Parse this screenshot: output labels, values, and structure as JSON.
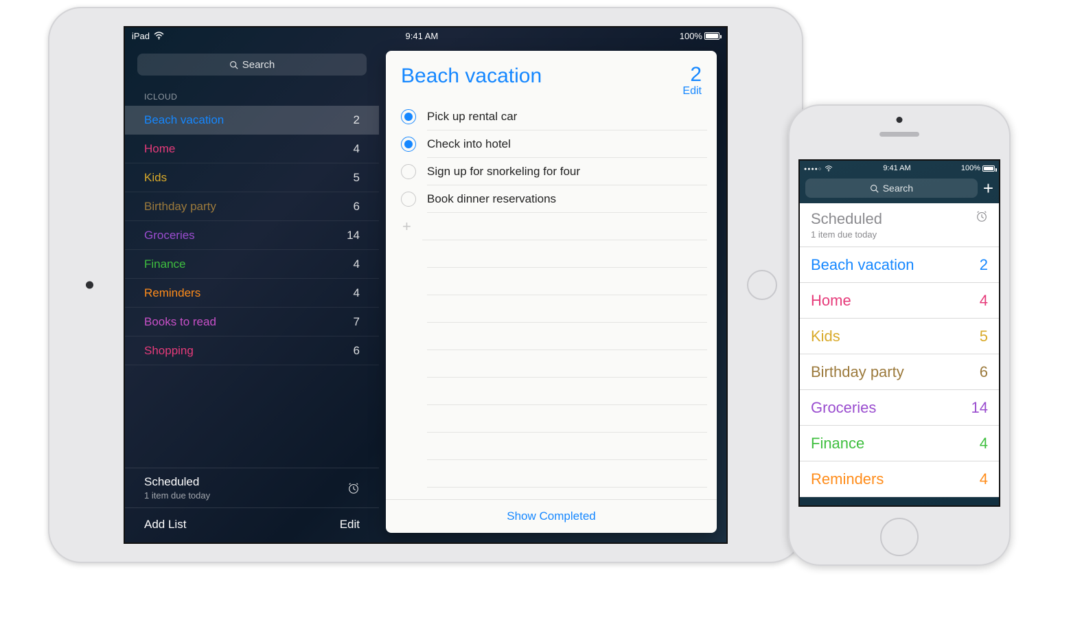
{
  "ipad": {
    "status": {
      "device": "iPad",
      "time": "9:41 AM",
      "battery": "100%"
    },
    "search_placeholder": "Search",
    "section_label": "ICLOUD",
    "lists": [
      {
        "name": "Beach vacation",
        "count": "2",
        "color": "#1587ff",
        "selected": true
      },
      {
        "name": "Home",
        "count": "4",
        "color": "#e63b7a"
      },
      {
        "name": "Kids",
        "count": "5",
        "color": "#d9aa2a"
      },
      {
        "name": "Birthday party",
        "count": "6",
        "color": "#9c7a3c"
      },
      {
        "name": "Groceries",
        "count": "14",
        "color": "#9a4dcf"
      },
      {
        "name": "Finance",
        "count": "4",
        "color": "#3fbf3f"
      },
      {
        "name": "Reminders",
        "count": "4",
        "color": "#ff8c1a"
      },
      {
        "name": "Books to read",
        "count": "7",
        "color": "#c850c8"
      },
      {
        "name": "Shopping",
        "count": "6",
        "color": "#e63b7a"
      }
    ],
    "scheduled": {
      "title": "Scheduled",
      "subtitle": "1 item due today"
    },
    "add_list": "Add List",
    "edit_sidebar": "Edit",
    "detail": {
      "title": "Beach vacation",
      "count": "2",
      "edit": "Edit",
      "items": [
        {
          "text": "Pick up rental car",
          "done": true
        },
        {
          "text": "Check into hotel",
          "done": true
        },
        {
          "text": "Sign up for snorkeling for four",
          "done": false
        },
        {
          "text": "Book dinner reservations",
          "done": false
        }
      ],
      "show_completed": "Show Completed"
    }
  },
  "iphone": {
    "status": {
      "time": "9:41 AM",
      "battery": "100%"
    },
    "search_placeholder": "Search",
    "scheduled": {
      "title": "Scheduled",
      "subtitle": "1 item due today"
    },
    "lists": [
      {
        "name": "Beach vacation",
        "count": "2",
        "color": "#1587ff"
      },
      {
        "name": "Home",
        "count": "4",
        "color": "#e63b7a"
      },
      {
        "name": "Kids",
        "count": "5",
        "color": "#d9aa2a"
      },
      {
        "name": "Birthday party",
        "count": "6",
        "color": "#9c7a3c"
      },
      {
        "name": "Groceries",
        "count": "14",
        "color": "#9a4dcf"
      },
      {
        "name": "Finance",
        "count": "4",
        "color": "#3fbf3f"
      },
      {
        "name": "Reminders",
        "count": "4",
        "color": "#ff8c1a"
      }
    ]
  }
}
